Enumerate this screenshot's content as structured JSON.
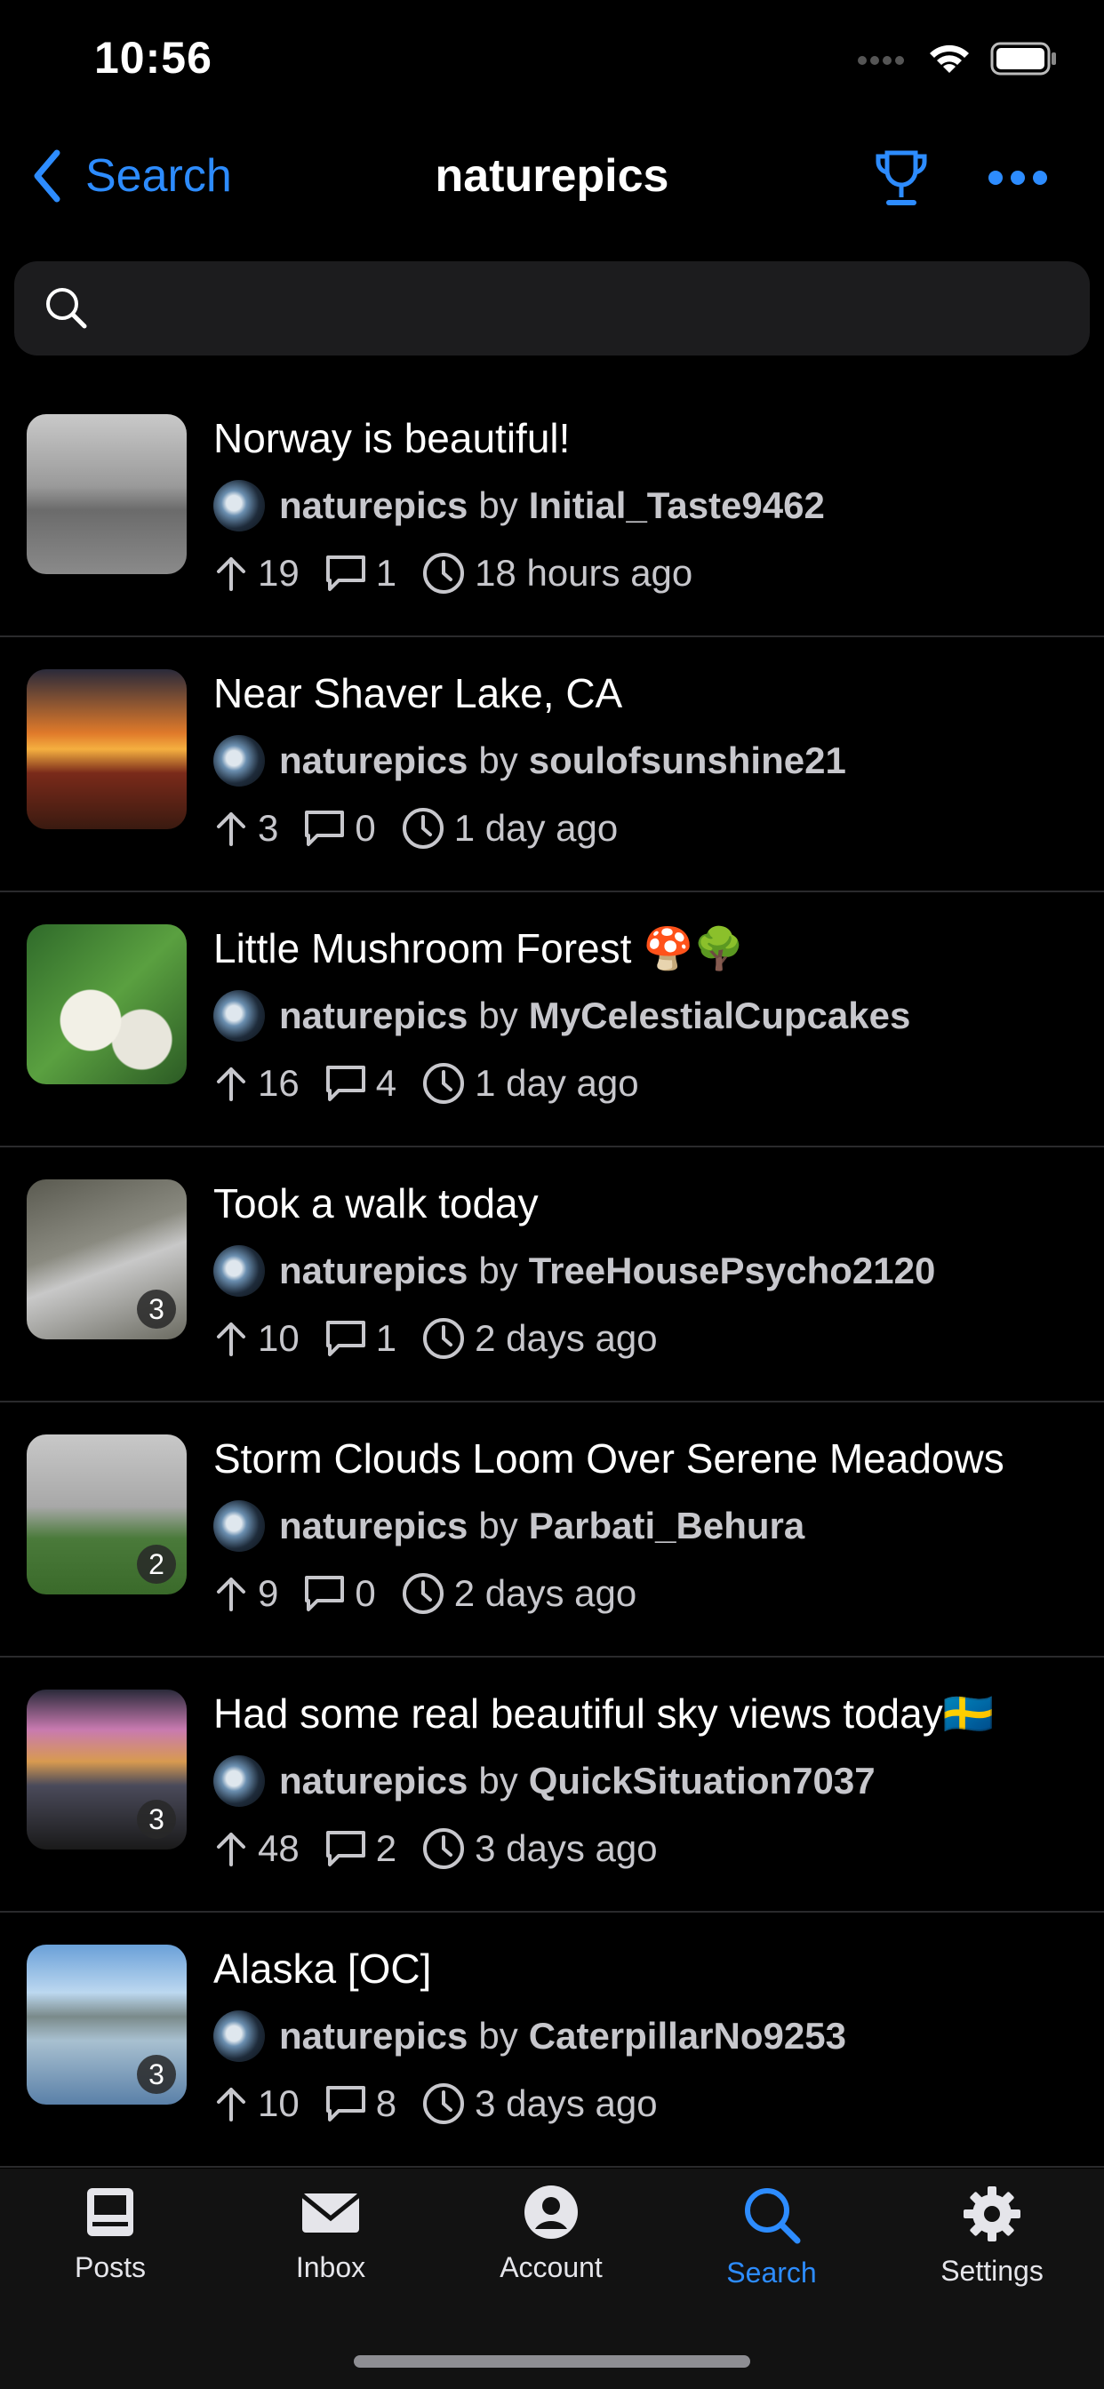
{
  "status": {
    "time": "10:56"
  },
  "nav": {
    "back_label": "Search",
    "title": "naturepics"
  },
  "search": {
    "value": "",
    "placeholder": ""
  },
  "posts": [
    {
      "title": "Norway is beautiful!",
      "community": "naturepics",
      "by": "by",
      "author": "Initial_Taste9462",
      "upvotes": "19",
      "comments": "1",
      "age": "18 hours ago",
      "badge": "",
      "thumb": "norway"
    },
    {
      "title": "Near Shaver Lake, CA",
      "community": "naturepics",
      "by": "by",
      "author": "soulofsunshine21",
      "upvotes": "3",
      "comments": "0",
      "age": "1 day ago",
      "badge": "",
      "thumb": "sunset"
    },
    {
      "title": "Little Mushroom Forest 🍄🌳",
      "community": "naturepics",
      "by": "by",
      "author": "MyCelestialCupcakes",
      "upvotes": "16",
      "comments": "4",
      "age": "1 day ago",
      "badge": "",
      "thumb": "mushroom"
    },
    {
      "title": "Took a walk today",
      "community": "naturepics",
      "by": "by",
      "author": "TreeHousePsycho2120",
      "upvotes": "10",
      "comments": "1",
      "age": "2 days ago",
      "badge": "3",
      "thumb": "walk"
    },
    {
      "title": "Storm Clouds Loom Over Serene Meadows",
      "community": "naturepics",
      "by": "by",
      "author": "Parbati_Behura",
      "upvotes": "9",
      "comments": "0",
      "age": "2 days ago",
      "badge": "2",
      "thumb": "storm"
    },
    {
      "title": "Had some real beautiful sky views today🇸🇪",
      "community": "naturepics",
      "by": "by",
      "author": "QuickSituation7037",
      "upvotes": "48",
      "comments": "2",
      "age": "3 days ago",
      "badge": "3",
      "thumb": "sky"
    },
    {
      "title": "Alaska [OC]",
      "community": "naturepics",
      "by": "by",
      "author": "CaterpillarNo9253",
      "upvotes": "10",
      "comments": "8",
      "age": "3 days ago",
      "badge": "3",
      "thumb": "alaska"
    }
  ],
  "tabs": [
    {
      "label": "Posts",
      "icon": "posts-icon"
    },
    {
      "label": "Inbox",
      "icon": "inbox-icon"
    },
    {
      "label": "Account",
      "icon": "account-icon"
    },
    {
      "label": "Search",
      "icon": "search-icon",
      "active": true
    },
    {
      "label": "Settings",
      "icon": "gear-icon"
    }
  ],
  "colors": {
    "accent": "#2d8cff",
    "background": "#000000",
    "secondary_text": "#c7c7cc",
    "search_bg": "#1c1c1e"
  }
}
